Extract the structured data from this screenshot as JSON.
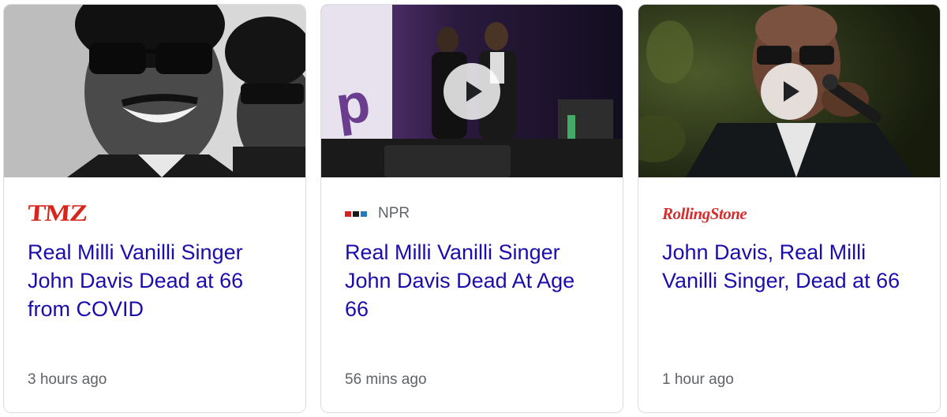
{
  "cards": [
    {
      "source": "TMZ",
      "headline": "Real Milli Vanilli Singer John Davis Dead at 66 from COVID",
      "time": "3 hours ago",
      "has_video": false,
      "logo_color": "#d7261e"
    },
    {
      "source": "NPR",
      "headline": "Real Milli Vanilli Singer John Davis Dead At Age 66",
      "time": "56 mins ago",
      "has_video": true,
      "logo_colors": [
        "#d62021",
        "#1a1a1a",
        "#237bbd"
      ]
    },
    {
      "source": "RollingStone",
      "headline": "John Davis, Real Milli Vanilli Singer, Dead at 66",
      "time": "1 hour ago",
      "has_video": true,
      "logo_color": "#d32f2f"
    }
  ],
  "colors": {
    "headline_link": "#1a0dab",
    "meta_text": "#5f6368",
    "card_border": "#dadce0"
  },
  "icons": {
    "play": "play-icon",
    "npr_logo": "npr-logo-icon"
  }
}
